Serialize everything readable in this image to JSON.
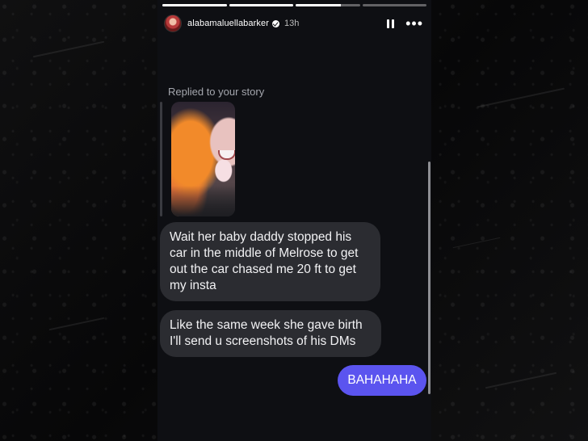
{
  "story": {
    "progress": [
      1.0,
      1.0,
      0.7,
      0.0
    ],
    "username": "alabamaluellabarker",
    "verified": true,
    "time": "13h",
    "pause_icon": "pause-icon",
    "more_icon": "more-icon"
  },
  "conversation": {
    "replied_label": "Replied to your story",
    "messages": [
      {
        "from": "them",
        "text": "Wait her baby daddy stopped his car in the middle of Melrose to get out the car chased me 20 ft to get my insta"
      },
      {
        "from": "them",
        "text": "Like the same week she gave birth I'll send u screenshots of his DMs"
      },
      {
        "from": "me",
        "text": "BAHAHAHA"
      }
    ]
  },
  "colors": {
    "my_bubble": "#5b54ef",
    "their_bubble": "#2b2c31",
    "background": "#0e0f13"
  }
}
